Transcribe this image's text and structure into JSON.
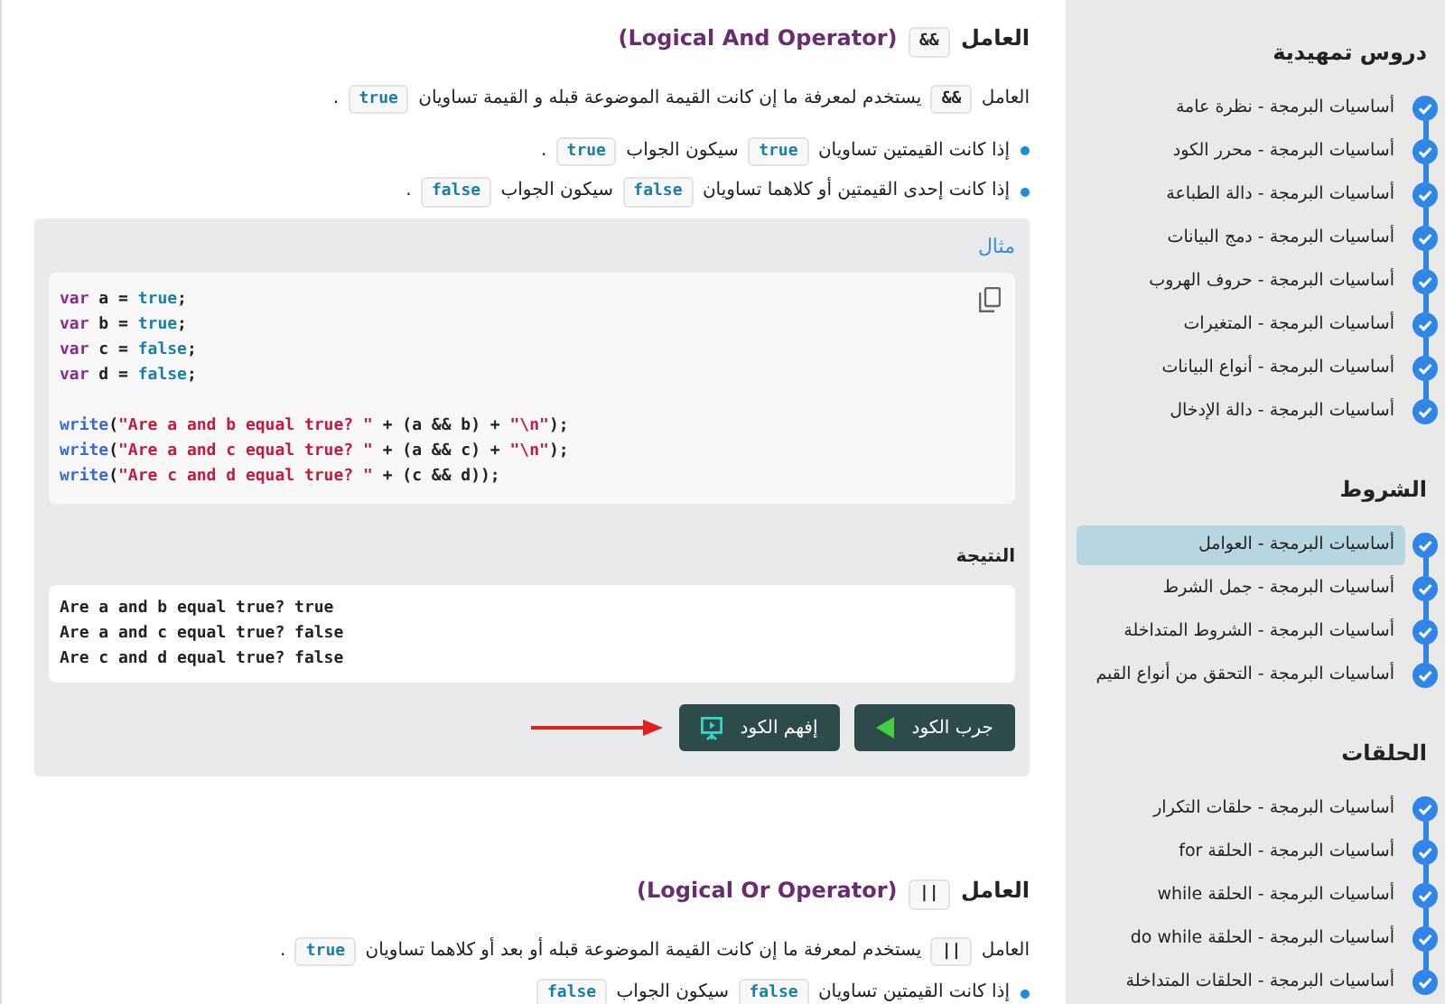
{
  "sections": [
    {
      "heading": [
        {
          "kind": "text",
          "text": "العامل "
        },
        {
          "kind": "code",
          "text": "&&"
        },
        {
          "kind": "english",
          "text": " (Logical And Operator)"
        }
      ],
      "paragraph": [
        {
          "kind": "text",
          "text": "العامل "
        },
        {
          "kind": "code",
          "text": "&&"
        },
        {
          "kind": "text",
          "text": " يستخدم لمعرفة ما إن كانت القيمة الموضوعة قبله و القيمة تساويان "
        },
        {
          "kind": "code",
          "text": "true"
        },
        {
          "kind": "text",
          "text": " ."
        }
      ],
      "bullets": [
        [
          {
            "kind": "text",
            "text": "إذا كانت القيمتين تساويان "
          },
          {
            "kind": "code",
            "text": "true"
          },
          {
            "kind": "text",
            "text": " سيكون الجواب "
          },
          {
            "kind": "code",
            "text": "true"
          },
          {
            "kind": "text",
            "text": " ."
          }
        ],
        [
          {
            "kind": "text",
            "text": "إذا كانت إحدى القيمتين أو كلاهما تساويان "
          },
          {
            "kind": "code",
            "text": "false"
          },
          {
            "kind": "text",
            "text": " سيكون الجواب "
          },
          {
            "kind": "code",
            "text": "false"
          },
          {
            "kind": "text",
            "text": " ."
          }
        ]
      ],
      "example": {
        "label": "مثال",
        "code": "var a = true;\nvar b = true;\nvar c = false;\nvar d = false;\n\nwrite(\"Are a and b equal true? \" + (a && b) + \"\\n\");\nwrite(\"Are a and c equal true? \" + (a && c) + \"\\n\");\nwrite(\"Are c and d equal true? \" + (c && d));",
        "result_label": "النتيجة",
        "output": [
          "Are a and b equal true? true",
          "Are a and c equal true? false",
          "Are c and d equal true? false"
        ],
        "buttons": [
          {
            "kind": "run",
            "label": "جرب الكود"
          },
          {
            "kind": "explain",
            "label": "إفهم الكود"
          }
        ]
      }
    },
    {
      "heading": [
        {
          "kind": "text",
          "text": "العامل "
        },
        {
          "kind": "code",
          "text": "||"
        },
        {
          "kind": "english",
          "text": " (Logical Or Operator)"
        }
      ],
      "paragraph": [
        {
          "kind": "text",
          "text": "العامل "
        },
        {
          "kind": "code",
          "text": "||"
        },
        {
          "kind": "text",
          "text": " يستخدم لمعرفة ما إن كانت القيمة الموضوعة قبله أو بعد أو كلاهما تساويان "
        },
        {
          "kind": "code",
          "text": "true"
        },
        {
          "kind": "text",
          "text": " ."
        }
      ],
      "bullets": [
        [
          {
            "kind": "text",
            "text": "إذا كانت القيمتين تساويان "
          },
          {
            "kind": "code",
            "text": "false"
          },
          {
            "kind": "text",
            "text": " سيكون الجواب "
          },
          {
            "kind": "code",
            "text": "false"
          }
        ]
      ]
    }
  ],
  "sidebar": [
    {
      "title": "دروس تمهيدية",
      "items": [
        {
          "label": "أساسيات البرمجة - نظرة عامة",
          "completed": true,
          "selected": false
        },
        {
          "label": "أساسيات البرمجة - محرر الكود",
          "completed": true,
          "selected": false
        },
        {
          "label": "أساسيات البرمجة - دالة الطباعة",
          "completed": true,
          "selected": false
        },
        {
          "label": "أساسيات البرمجة - دمج البيانات",
          "completed": true,
          "selected": false
        },
        {
          "label": "أساسيات البرمجة - حروف الهروب",
          "completed": true,
          "selected": false
        },
        {
          "label": "أساسيات البرمجة - المتغيرات",
          "completed": true,
          "selected": false
        },
        {
          "label": "أساسيات البرمجة - أنواع البيانات",
          "completed": true,
          "selected": false
        },
        {
          "label": "أساسيات البرمجة - دالة الإدخال",
          "completed": true,
          "selected": false
        }
      ]
    },
    {
      "title": "الشروط",
      "items": [
        {
          "label": "أساسيات البرمجة - العوامل",
          "completed": true,
          "selected": true
        },
        {
          "label": "أساسيات البرمجة - جمل الشرط",
          "completed": true,
          "selected": false
        },
        {
          "label": "أساسيات البرمجة - الشروط المتداخلة",
          "completed": true,
          "selected": false
        },
        {
          "label": "أساسيات البرمجة - التحقق من أنواع القيم",
          "completed": true,
          "selected": false
        }
      ]
    },
    {
      "title": "الحلقات",
      "items": [
        {
          "label": "أساسيات البرمجة - حلقات التكرار",
          "completed": true,
          "selected": false
        },
        {
          "label": "أساسيات البرمجة - الحلقة for",
          "completed": true,
          "selected": false
        },
        {
          "label": "أساسيات البرمجة - الحلقة while",
          "completed": true,
          "selected": false
        },
        {
          "label": "أساسيات البرمجة - الحلقة do while",
          "completed": true,
          "selected": false
        },
        {
          "label": "أساسيات البرمجة - الحلقات المتداخلة",
          "completed": true,
          "selected": false
        }
      ]
    }
  ]
}
